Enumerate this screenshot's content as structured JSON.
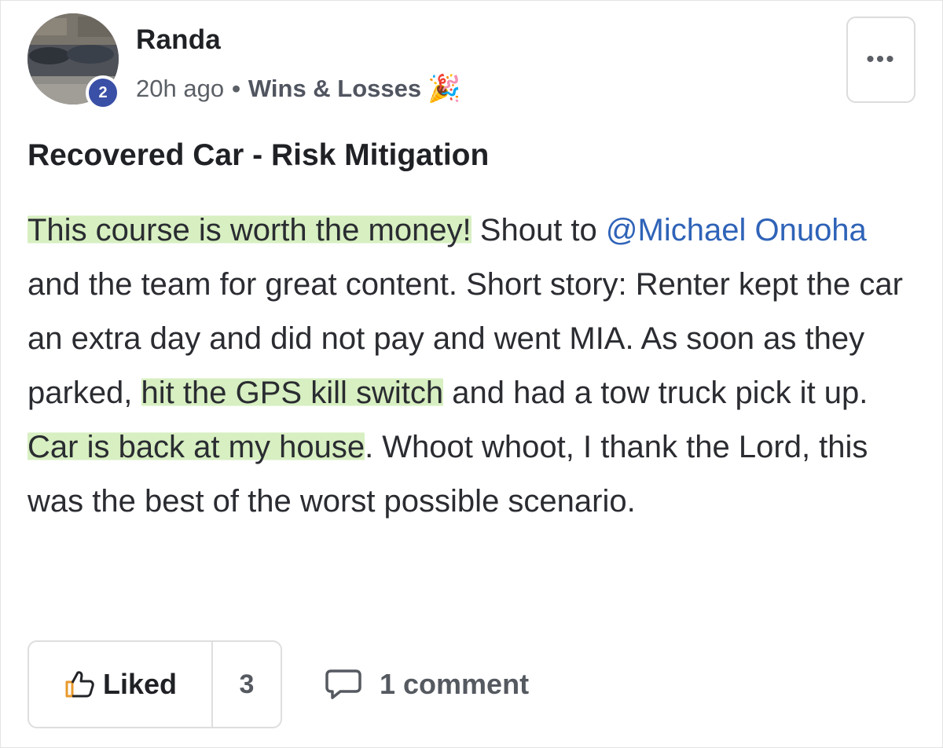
{
  "author": {
    "name": "Randa",
    "level": "2",
    "avatar_icon": "avatar-photo-cars"
  },
  "meta": {
    "time": "20h ago",
    "separator": "•",
    "category": "Wins & Losses",
    "category_icon": "party-popper-icon",
    "category_emoji": "🎉"
  },
  "menu": {
    "more_icon": "more-dots-icon",
    "more_label": "•••"
  },
  "post": {
    "title": "Recovered Car - Risk Mitigation",
    "body": {
      "p1": "This course is worth the money!",
      "p2": " Shout to ",
      "mention": "@Michael Onuoha",
      "p3": " and the team for great content. Short story: Renter kept the car an extra day and did not pay and went MIA. As soon as they parked, ",
      "p4": "hit the GPS kill switch",
      "p5": " and had a tow truck pick it up. ",
      "p6": "Car is back at my house",
      "p7": ". Whoot whoot, I thank the Lord, this was the best of the worst possible scenario."
    }
  },
  "actions": {
    "like_label": "Liked",
    "like_count": "3",
    "comment_label": "1 comment"
  },
  "colors": {
    "highlight": "#d5eebe",
    "mention": "#2f63b8",
    "badge": "#3a4fa6"
  }
}
